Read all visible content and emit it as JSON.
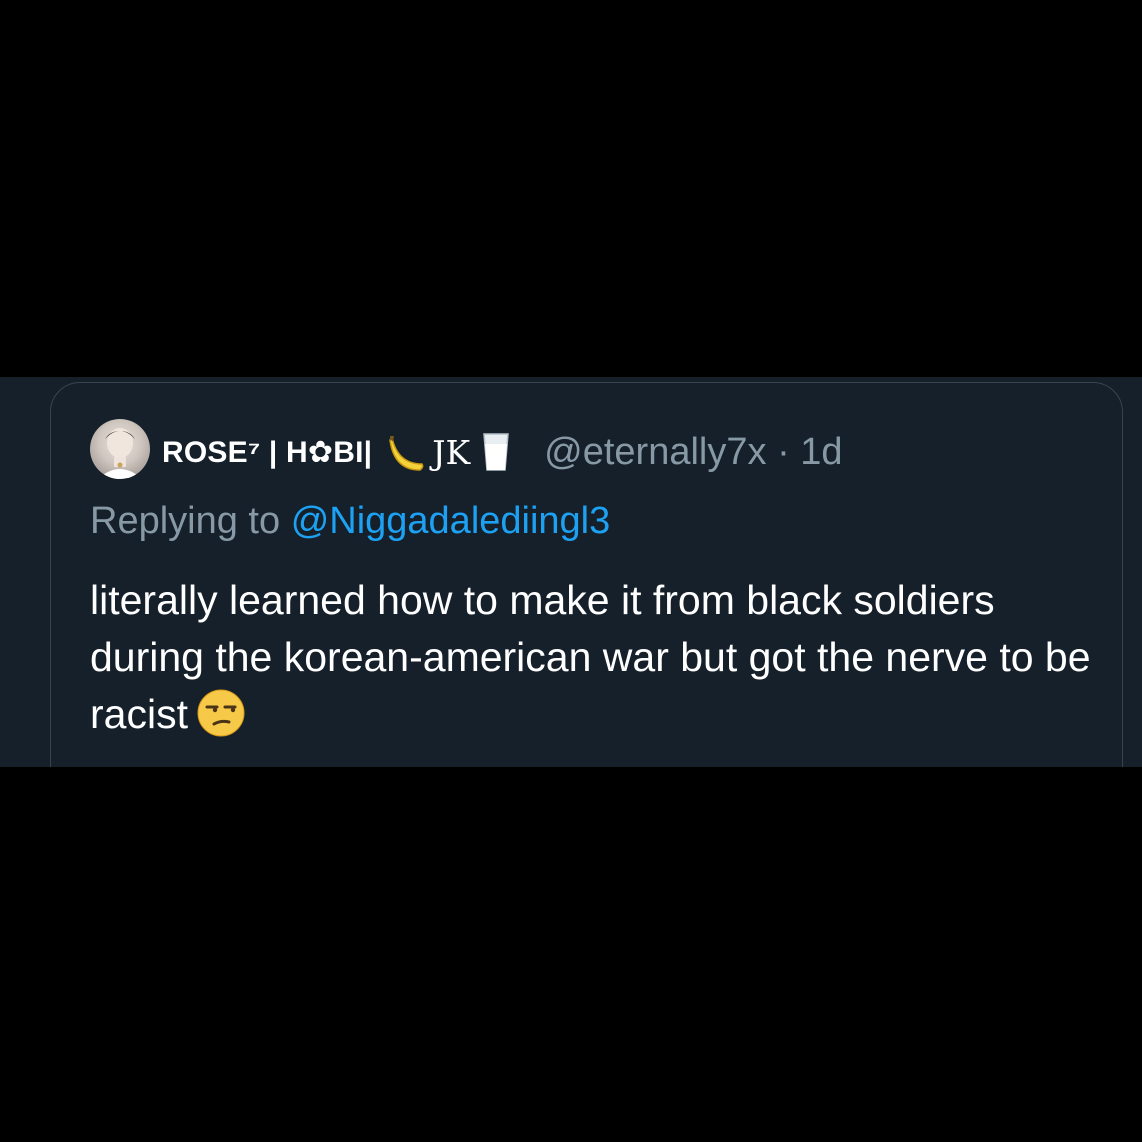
{
  "tweet": {
    "display_name": "ROSE⁷ | H✿BI|",
    "name_suffix": "JK",
    "handle": "@eternally7x",
    "separator": "·",
    "time": "1d",
    "reply_prefix": "Replying to",
    "reply_mention": "@Niggadalediingl3",
    "text": "literally learned how to make it from black soldiers during the korean-american war but got the nerve to be racist",
    "icons": [
      "avatar",
      "banana-icon",
      "milk-glass-icon",
      "unamused-face-icon"
    ]
  },
  "colors": {
    "background": "#000000",
    "card": "#15202b",
    "text": "#ffffff",
    "muted": "#8899a6",
    "accent": "#1da1f2"
  }
}
